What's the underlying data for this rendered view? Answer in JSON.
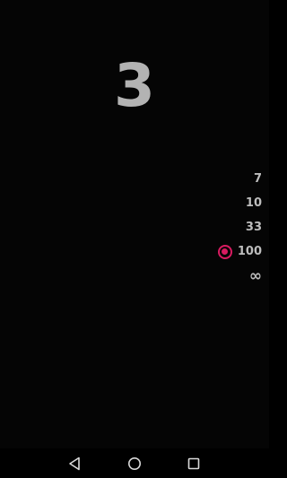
{
  "counter": {
    "value": "3"
  },
  "limits": {
    "options": [
      {
        "label": "7",
        "selected": false
      },
      {
        "label": "10",
        "selected": false
      },
      {
        "label": "33",
        "selected": false
      },
      {
        "label": "100",
        "selected": true
      },
      {
        "label": "∞",
        "selected": false
      }
    ]
  },
  "colors": {
    "accent": "#d81b60",
    "counter_text": "#b3b3b3",
    "label_text": "#bdbdbd",
    "background": "#050505"
  },
  "navbar": {
    "icons": [
      "back-icon",
      "home-icon",
      "recents-icon"
    ]
  }
}
